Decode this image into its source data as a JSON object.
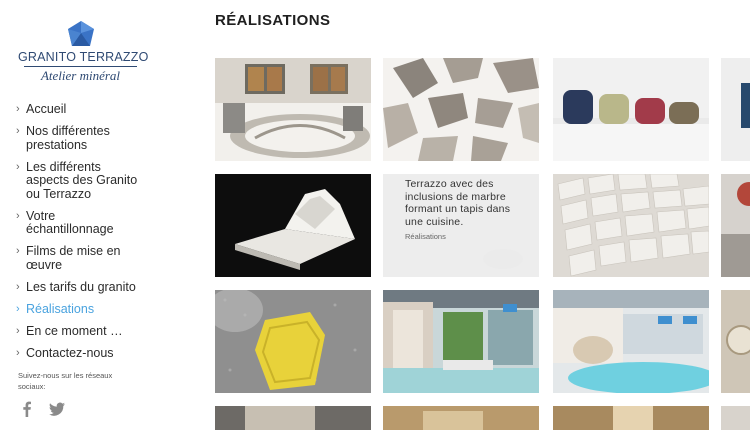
{
  "brand": {
    "name": "GRANITO TERRAZZO",
    "tagline": "Atelier minéral",
    "color": "#2f4a73"
  },
  "menu": {
    "items": [
      {
        "label": "Accueil"
      },
      {
        "label": "Nos différentes prestations"
      },
      {
        "label": "Les différents aspects des Granito ou Terrazzo"
      },
      {
        "label": "Votre échantillonnage"
      },
      {
        "label": "Films de mise en œuvre"
      },
      {
        "label": "Les tarifs du granito"
      },
      {
        "label": "Réalisations"
      },
      {
        "label": "En ce moment …"
      },
      {
        "label": "Contactez-nous"
      }
    ],
    "active_index": 6,
    "active_color": "#4aa3df"
  },
  "social": {
    "label": "Suivez-nous sur les réseaux sociaux:",
    "icons": [
      "facebook-icon",
      "twitter-icon"
    ]
  },
  "page": {
    "title": "RÉALISATIONS"
  },
  "gallery": {
    "hover_caption": "Terrazzo avec des inclusions de marbre formant un tapis dans une cuisine.",
    "hover_category": "Réalisations"
  }
}
